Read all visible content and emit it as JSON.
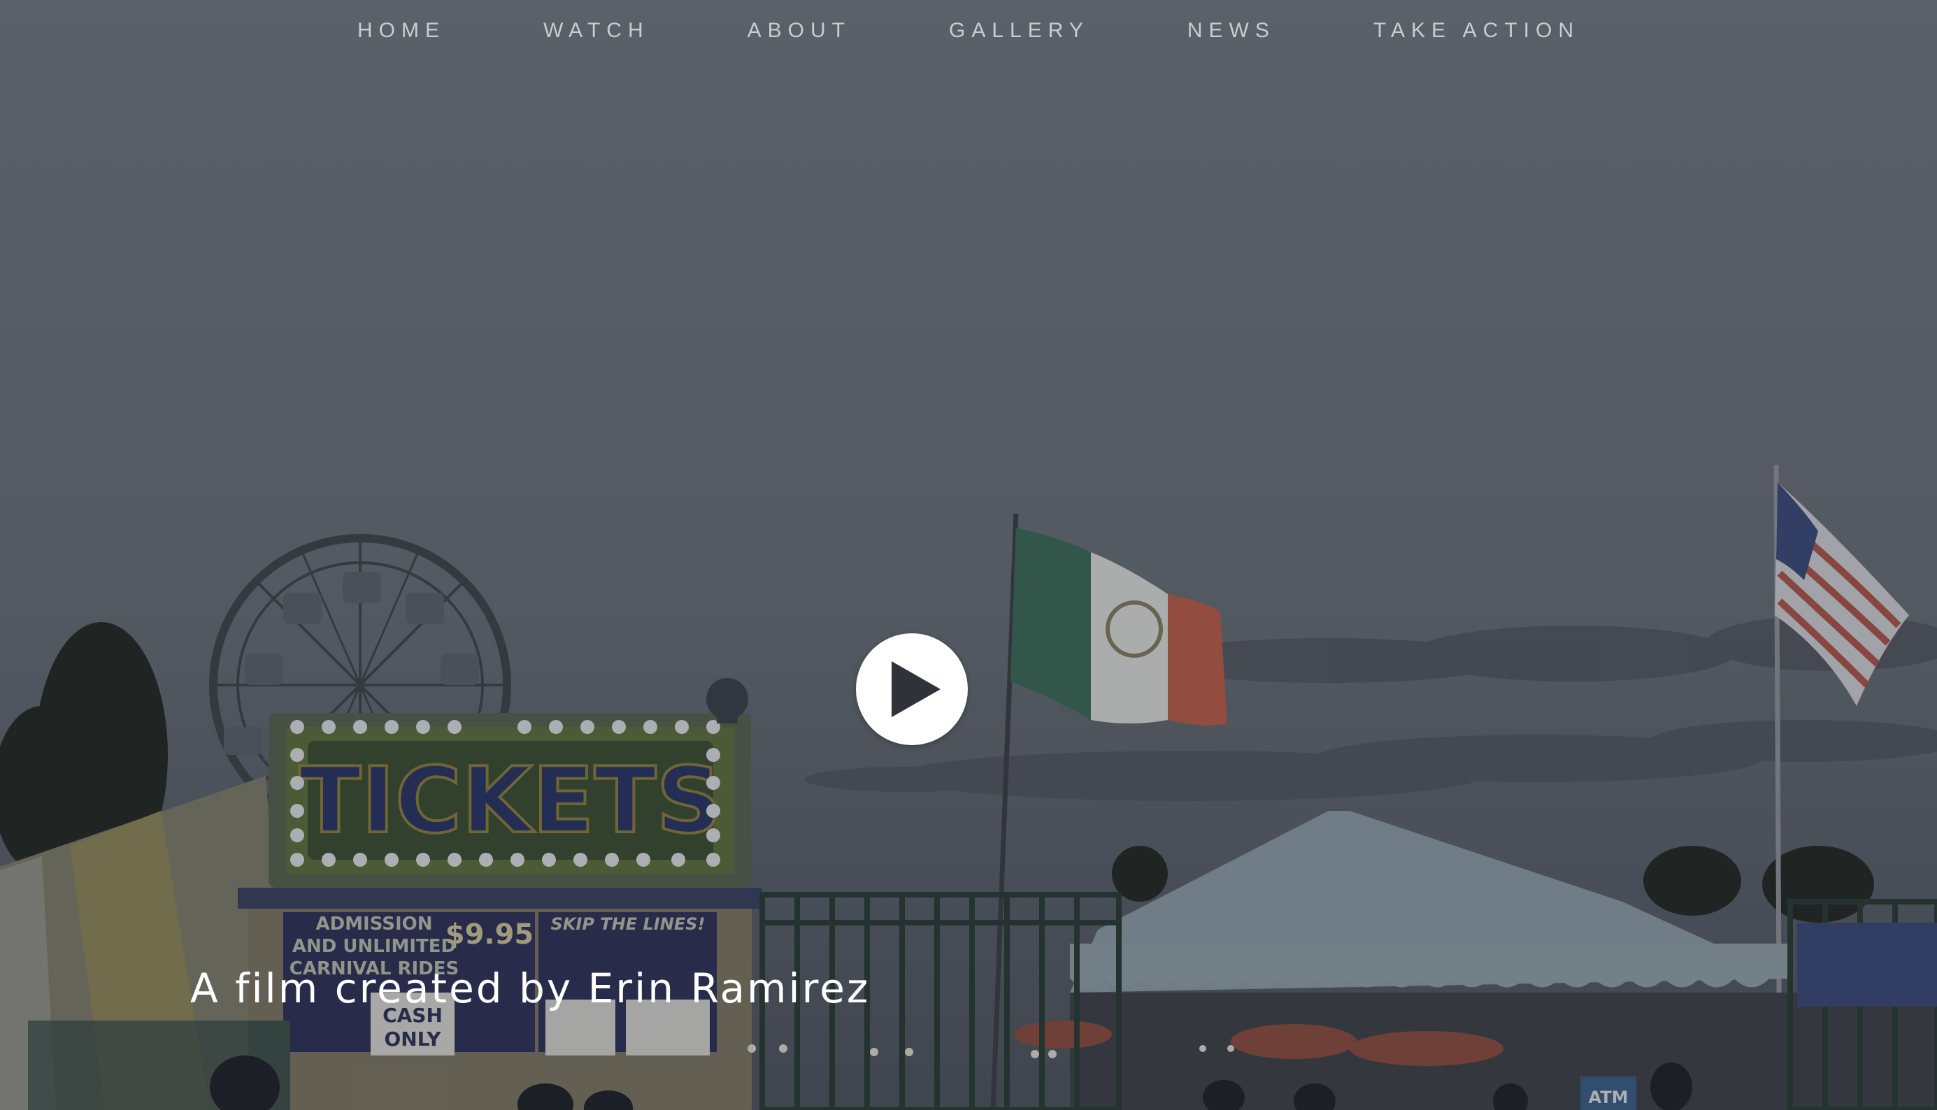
{
  "nav": {
    "items": [
      {
        "label": "HOME"
      },
      {
        "label": "WATCH"
      },
      {
        "label": "ABOUT"
      },
      {
        "label": "GALLERY"
      },
      {
        "label": "NEWS"
      },
      {
        "label": "TAKE ACTION"
      }
    ]
  },
  "hero": {
    "tagline": "A film created by Erin Ramirez",
    "play_icon": "play-icon",
    "booth_sign": "TICKETS",
    "booth_text": {
      "admission": "ADMISSION AND UNLIMITED CARNIVAL RIDES",
      "price": "$9.95",
      "skip": "SKIP THE LINES!",
      "cash": "CASH ONLY"
    },
    "atm_sign": "ATM"
  },
  "colors": {
    "nav_text": "#c9ccd0",
    "tagline": "#ffffff",
    "play_button": "#ffffff",
    "sky": "#6c737b"
  }
}
